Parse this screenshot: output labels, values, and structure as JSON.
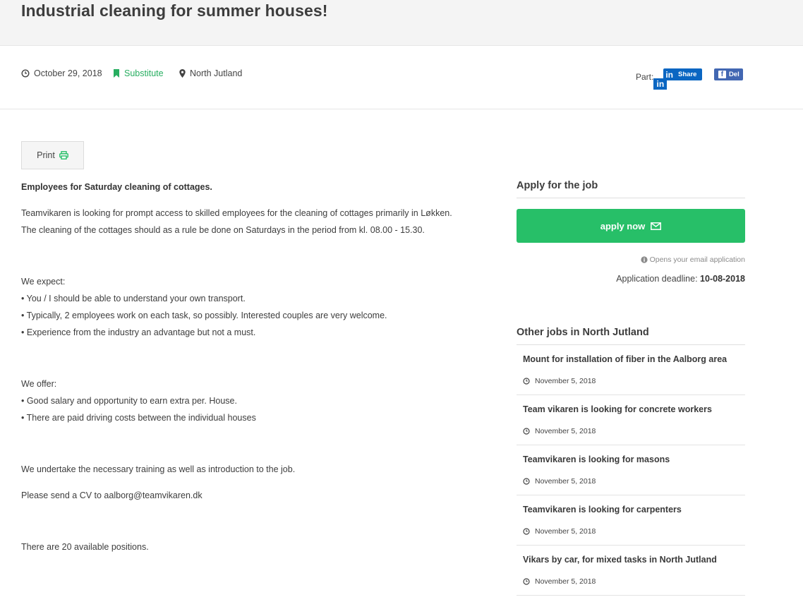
{
  "header": {
    "title": "Industrial cleaning for summer houses!"
  },
  "meta": {
    "date": "October 29, 2018",
    "category": "Substitute",
    "location": "North Jutland",
    "share_label": "Part:",
    "linkedin_short": "in",
    "linkedin_label": "Share",
    "facebook_label": "Del",
    "facebook_icon": "f"
  },
  "print_label": "Print",
  "body": {
    "intro": "Employees for Saturday cleaning of cottages.",
    "p1": "Teamvikaren is looking for prompt access to skilled employees for the cleaning of cottages primarily in Løkken.",
    "p2": "The cleaning of the cottages should as a rule be done on Saturdays in the period from kl. 08.00 - 15.30.",
    "expect_heading": "We expect:",
    "expect": [
      "• You / I should be able to understand your own transport.",
      "• Typically, 2 employees work on each task, so possibly. Interested couples are very welcome.",
      "• Experience from the industry an advantage but not a must."
    ],
    "offer_heading": "We offer:",
    "offer": [
      "• Good salary and opportunity to earn extra per. House.",
      "• There are paid driving costs between the individual houses"
    ],
    "training": "We undertake the necessary training as well as introduction to the job.",
    "cv": "Please send a CV to aalborg@teamvikaren.dk",
    "positions": "There are 20 available positions."
  },
  "apply": {
    "title": "Apply for the job",
    "button": "apply now",
    "note": "Opens your email application",
    "deadline_label": "Application deadline:",
    "deadline_value": "10-08-2018"
  },
  "other_jobs": {
    "title": "Other jobs in North Jutland",
    "items": [
      {
        "title": "Mount for installation of fiber in the Aalborg area",
        "date": "November 5, 2018"
      },
      {
        "title": "Team vikaren is looking for concrete workers",
        "date": "November 5, 2018"
      },
      {
        "title": "Teamvikaren is looking for masons",
        "date": "November 5, 2018"
      },
      {
        "title": "Teamvikaren is looking for carpenters",
        "date": "November 5, 2018"
      },
      {
        "title": "Vikars by car, for mixed tasks in North Jutland",
        "date": "November 5, 2018"
      }
    ]
  },
  "colors": {
    "accent": "#27bf68",
    "linkedin": "#0a66c2",
    "facebook": "#4267b2"
  }
}
